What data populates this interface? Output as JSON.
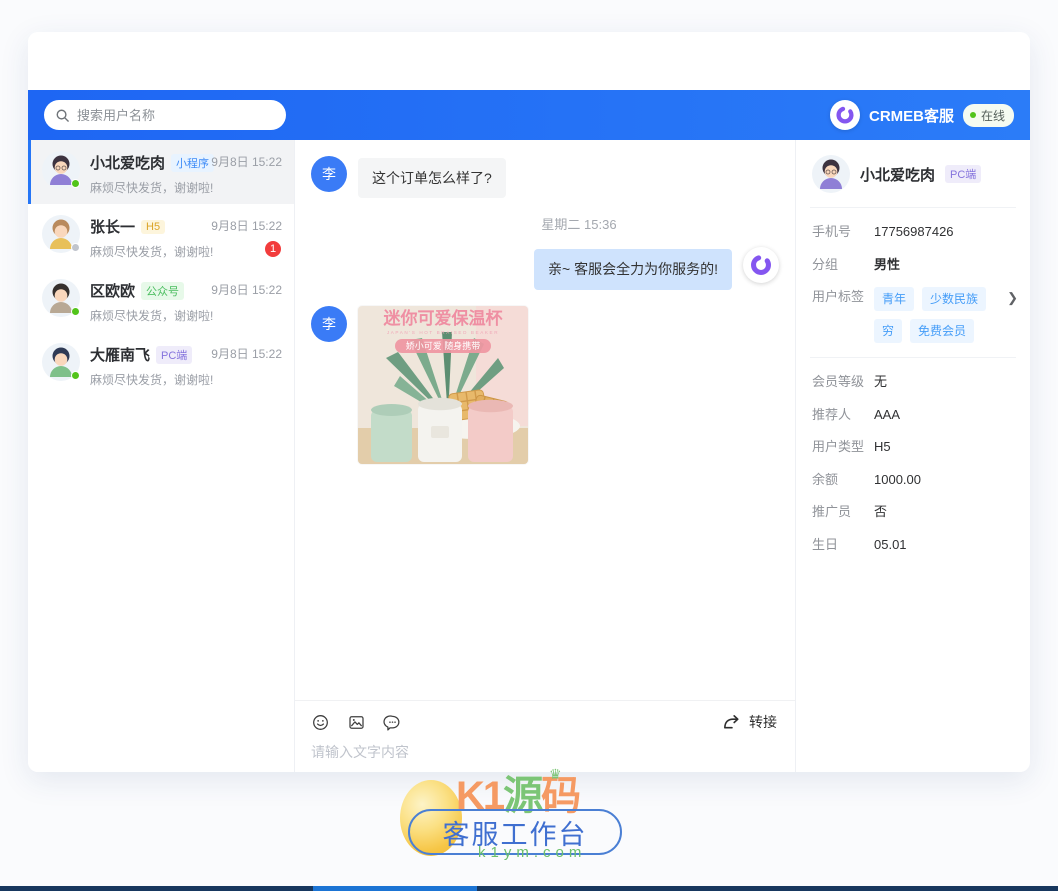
{
  "header": {
    "search_placeholder": "搜索用户名称",
    "brand": "CRMEB客服",
    "status": "在线"
  },
  "sidebar": {
    "contacts": [
      {
        "name": "小北爱吃肉",
        "badge": "小程序",
        "time": "9月8日 15:22",
        "preview": "麻烦尽快发货，谢谢啦!"
      },
      {
        "name": "张长一",
        "badge": "H5",
        "time": "9月8日 15:22",
        "preview": "麻烦尽快发货，谢谢啦!",
        "unread": "1"
      },
      {
        "name": "区欧欧",
        "badge": "公众号",
        "time": "9月8日 15:22",
        "preview": "麻烦尽快发货，谢谢啦!"
      },
      {
        "name": "大雁南飞",
        "badge": "PC端",
        "time": "9月8日 15:22",
        "preview": "麻烦尽快发货，谢谢啦!"
      }
    ]
  },
  "chat": {
    "peer_initial": "李",
    "message_in": "这个订单怎么样了?",
    "time_divider": "星期二 15:36",
    "message_out": "亲~ 客服会全力为你服务的!",
    "product": {
      "title": "迷你可爱保温杯",
      "subtitle": "JAPAN'S HOT BRAISED BEAKER",
      "tag": "娇小可爱 随身携带"
    },
    "transfer_label": "转接",
    "input_placeholder": "请输入文字内容"
  },
  "profile": {
    "name": "小北爱吃肉",
    "badge": "PC端",
    "fields_top": [
      {
        "label": "手机号",
        "value": "17756987426"
      },
      {
        "label": "分组",
        "value": "男性"
      }
    ],
    "tags_label": "用户标签",
    "tags": [
      "青年",
      "少数民族",
      "穷",
      "免费会员"
    ],
    "fields_bottom": [
      {
        "label": "会员等级",
        "value": "无"
      },
      {
        "label": "推荐人",
        "value": "AAA"
      },
      {
        "label": "用户类型",
        "value": "H5"
      },
      {
        "label": "余额",
        "value": "1000.00"
      },
      {
        "label": "推广员",
        "value": "否"
      },
      {
        "label": "生日",
        "value": "05.01"
      }
    ]
  },
  "watermark": {
    "brand_prefix": "K1",
    "brand_green": "源",
    "brand_suffix": "码",
    "stamp": "客服工作台",
    "domain": "k1ym.com"
  }
}
